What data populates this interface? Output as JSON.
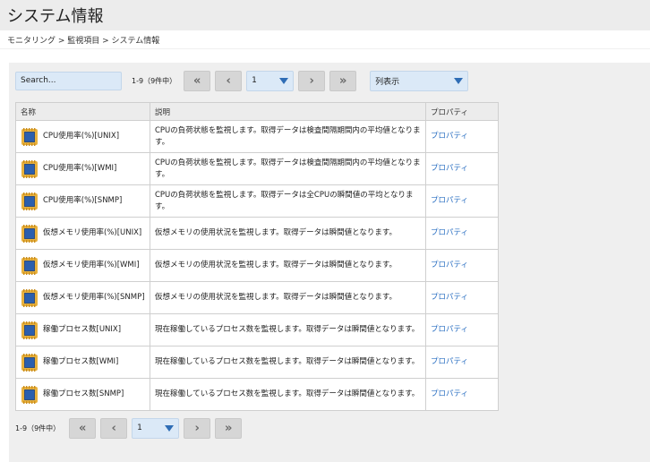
{
  "page": {
    "title": "システム情報",
    "breadcrumb": "モニタリング > 監視項目 > システム情報"
  },
  "toolbar": {
    "search_placeholder": "Search...",
    "count": "1-9（9件中）",
    "first_icon": "«",
    "prev_icon": "‹",
    "next_icon": "›",
    "last_icon": "»",
    "page_value": "1",
    "columns_label": "列表示"
  },
  "table": {
    "headers": {
      "name": "名称",
      "desc": "説明",
      "prop": "プロパティ"
    },
    "rows": [
      {
        "name": "CPU使用率(%)[UNIX]",
        "desc": "CPUの負荷状態を監視します。取得データは検査間隔期間内の平均値となります。",
        "prop": "プロパティ"
      },
      {
        "name": "CPU使用率(%)[WMI]",
        "desc": "CPUの負荷状態を監視します。取得データは検査間隔期間内の平均値となります。",
        "prop": "プロパティ"
      },
      {
        "name": "CPU使用率(%)[SNMP]",
        "desc": "CPUの負荷状態を監視します。取得データは全CPUの瞬間値の平均となります。",
        "prop": "プロパティ"
      },
      {
        "name": "仮想メモリ使用率(%)[UNIX]",
        "desc": "仮想メモリの使用状況を監視します。取得データは瞬間値となります。",
        "prop": "プロパティ"
      },
      {
        "name": "仮想メモリ使用率(%)[WMI]",
        "desc": "仮想メモリの使用状況を監視します。取得データは瞬間値となります。",
        "prop": "プロパティ"
      },
      {
        "name": "仮想メモリ使用率(%)[SNMP]",
        "desc": "仮想メモリの使用状況を監視します。取得データは瞬間値となります。",
        "prop": "プロパティ"
      },
      {
        "name": "稼働プロセス数[UNIX]",
        "desc": "現在稼働しているプロセス数を監視します。取得データは瞬間値となります。",
        "prop": "プロパティ"
      },
      {
        "name": "稼働プロセス数[WMI]",
        "desc": "現在稼働しているプロセス数を監視します。取得データは瞬間値となります。",
        "prop": "プロパティ"
      },
      {
        "name": "稼働プロセス数[SNMP]",
        "desc": "現在稼働しているプロセス数を監視します。取得データは瞬間値となります。",
        "prop": "プロパティ"
      }
    ]
  },
  "footer": {
    "count": "1-9（9件中）",
    "first_icon": "«",
    "prev_icon": "‹",
    "next_icon": "›",
    "last_icon": "»",
    "page_value": "1"
  },
  "icons": {
    "row_icon": "cpu-chip-icon"
  },
  "colors": {
    "link": "#2a6fc2",
    "select_bg": "#dbe9f7",
    "header_bg": "#ececec"
  }
}
